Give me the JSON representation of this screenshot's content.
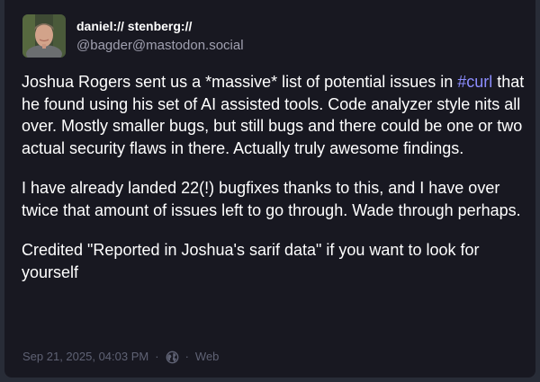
{
  "author": {
    "display_name": "daniel:// stenberg://",
    "handle": "@bagder@mastodon.social"
  },
  "post": {
    "p1_before": "Joshua Rogers sent us a *massive* list of potential issues in ",
    "p1_hashtag": "#curl",
    "p1_after": " that he found using his set of AI assisted tools. Code analyzer style nits all over. Mostly smaller bugs, but still bugs and there could be one or two actual security flaws in there. Actually truly awesome findings.",
    "p2": "I have already landed 22(!) bugfixes thanks to this, and I have over twice that amount of issues left to go through. Wade through perhaps.",
    "p3": "Credited \"Reported in Joshua's sarif data\" if you want to look for yourself"
  },
  "meta": {
    "timestamp": "Sep 21, 2025, 04:03 PM",
    "separator": "·",
    "visibility_icon": "globe-icon",
    "application": "Web"
  },
  "colors": {
    "page_bg": "#282c37",
    "card_bg": "#181821",
    "text": "#ffffff",
    "muted": "#5f6274",
    "hashtag": "#8c8dff"
  }
}
